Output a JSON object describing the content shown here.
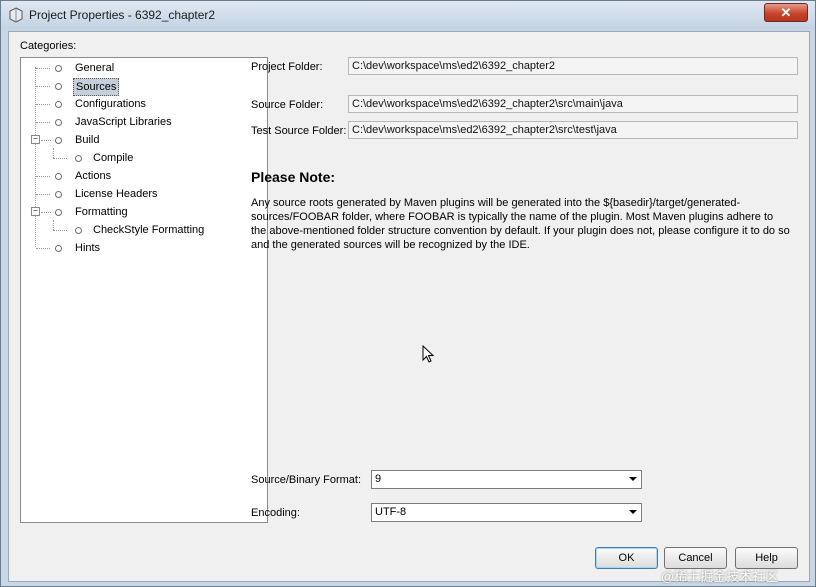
{
  "window": {
    "title": "Project Properties - 6392_chapter2",
    "close_label": "✕"
  },
  "categories_label": "Categories:",
  "tree": [
    {
      "label": "General",
      "selected": false
    },
    {
      "label": "Sources",
      "selected": true
    },
    {
      "label": "Configurations",
      "selected": false
    },
    {
      "label": "JavaScript Libraries",
      "selected": false
    },
    {
      "label": "Build",
      "selected": false
    },
    {
      "label": "Compile",
      "selected": false
    },
    {
      "label": "Actions",
      "selected": false
    },
    {
      "label": "License Headers",
      "selected": false
    },
    {
      "label": "Formatting",
      "selected": false
    },
    {
      "label": "CheckStyle Formatting",
      "selected": false
    },
    {
      "label": "Hints",
      "selected": false
    }
  ],
  "fields": {
    "project_folder_label": "Project Folder:",
    "project_folder_value": "C:\\dev\\workspace\\ms\\ed2\\6392_chapter2",
    "source_folder_label": "Source Folder:",
    "source_folder_value": "C:\\dev\\workspace\\ms\\ed2\\6392_chapter2\\src\\main\\java",
    "test_source_folder_label": "Test Source Folder:",
    "test_source_folder_value": "C:\\dev\\workspace\\ms\\ed2\\6392_chapter2\\src\\test\\java"
  },
  "note": {
    "title": "Please Note:",
    "body": "Any source roots generated by Maven plugins will be generated into the ${basedir}/target/generated-sources/FOOBAR folder, where FOOBAR is typically the name of the plugin. Most Maven plugins adhere to the above-mentioned folder structure convention by default. If your plugin does not, please configure it to do so and the generated sources will be recognized by the IDE."
  },
  "format": {
    "source_binary_label": "Source/Binary Format:",
    "source_binary_value": "9",
    "encoding_label": "Encoding:",
    "encoding_value": "UTF-8"
  },
  "buttons": {
    "ok": "OK",
    "cancel": "Cancel",
    "help": "Help"
  },
  "watermark": "@稀土掘金技术社区"
}
